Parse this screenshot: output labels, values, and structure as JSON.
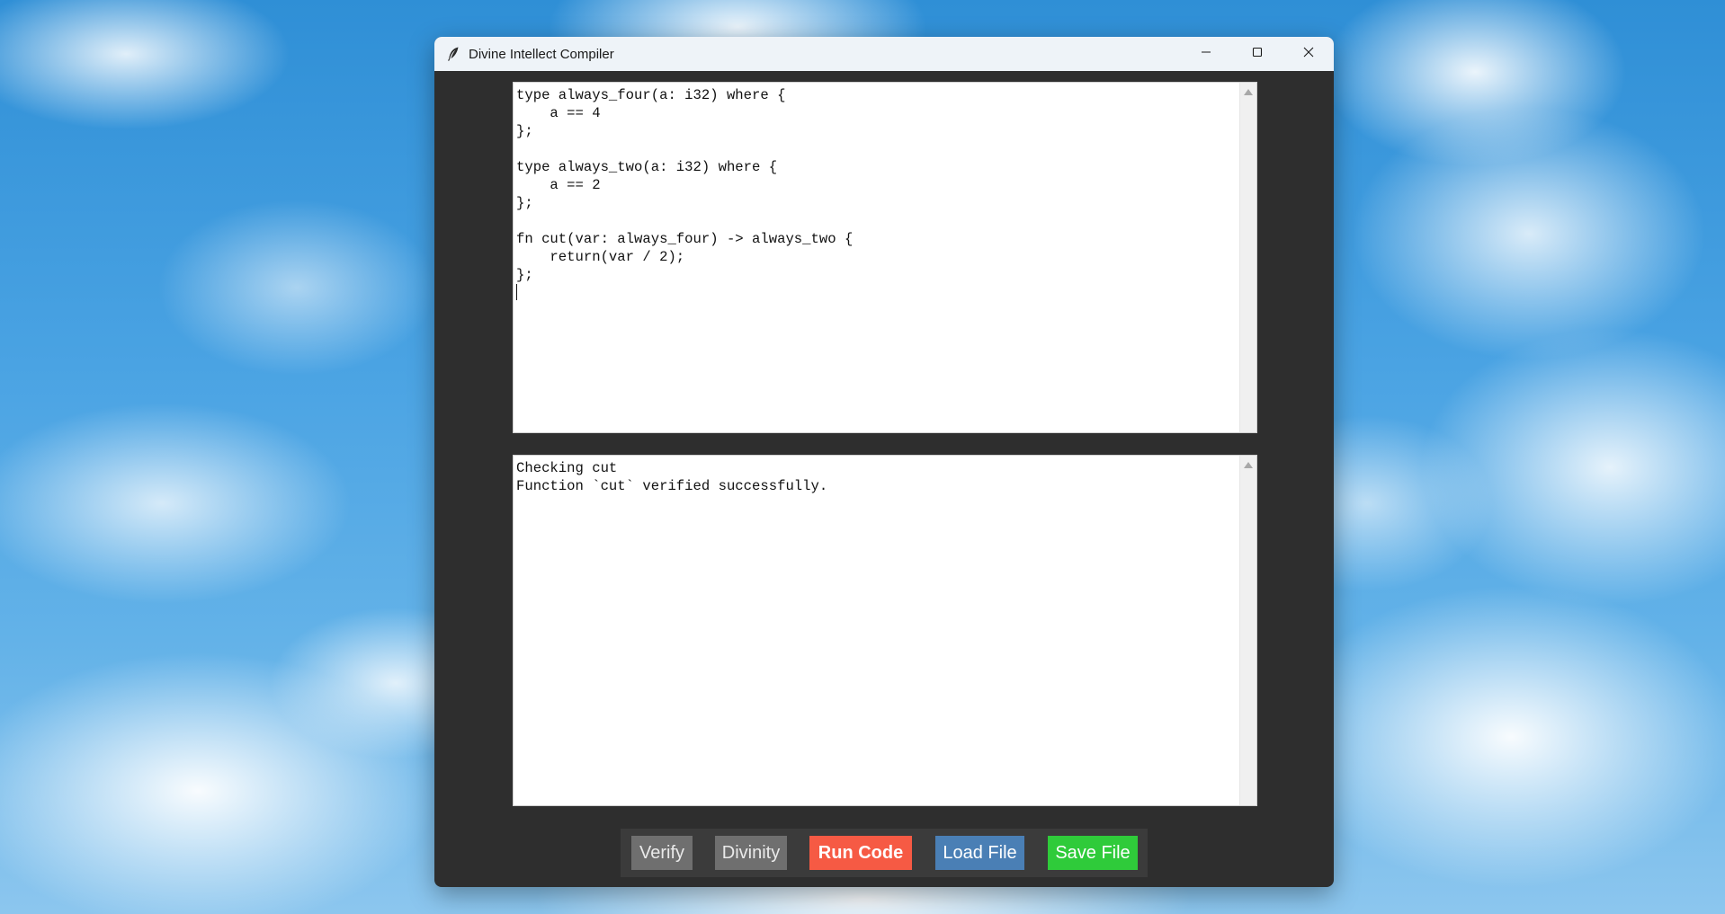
{
  "desktop": {
    "wallpaper": "blue-sky-clouds"
  },
  "window": {
    "title": "Divine Intellect Compiler",
    "app_icon": "feather-icon",
    "controls": {
      "minimize_icon": "minimize-icon",
      "maximize_icon": "maximize-icon",
      "close_icon": "close-icon"
    }
  },
  "editor": {
    "code": "type always_four(a: i32) where {\n    a == 4\n};\n\ntype always_two(a: i32) where {\n    a == 2\n};\n\nfn cut(var: always_four) -> always_two {\n    return(var / 2);\n};\n"
  },
  "output": {
    "text": "Checking cut\nFunction `cut` verified successfully."
  },
  "toolbar": {
    "verify_label": "Verify",
    "divinity_label": "Divinity",
    "run_label": "Run Code",
    "load_label": "Load File",
    "save_label": "Save File"
  },
  "colors": {
    "window_bg": "#2e2e2e",
    "toolbar_bg": "#3b3b3b",
    "neutral_button": "#6f6f6f",
    "run_button": "#f65a44",
    "load_button": "#4a7fb5",
    "save_button": "#2fcb3a"
  }
}
